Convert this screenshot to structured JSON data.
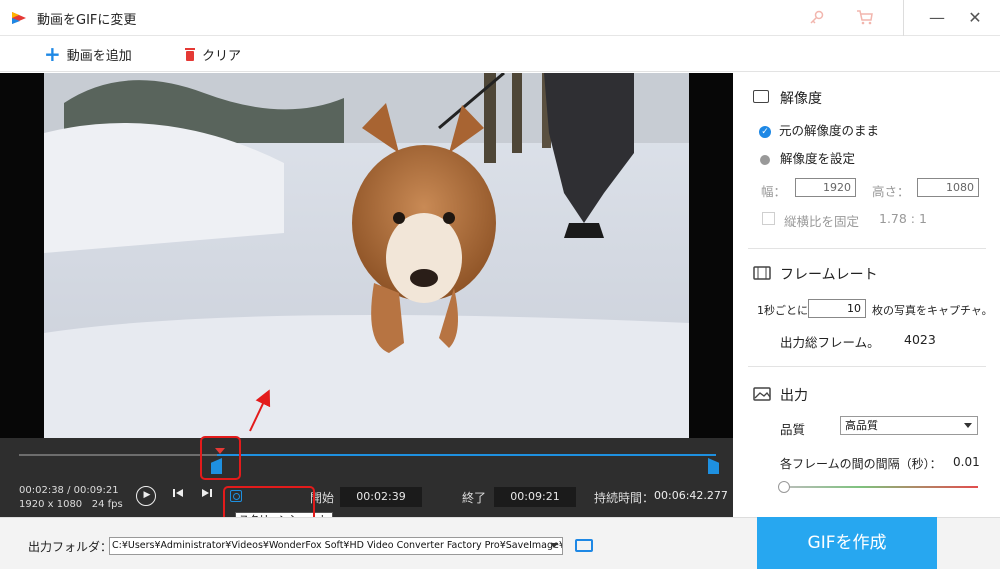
{
  "app": {
    "title": "動画をGIFに変更"
  },
  "icons": {
    "logo": "app-logo-icon",
    "key": "key-icon",
    "cart": "cart-icon"
  },
  "colors": {
    "accent": "#1e88e5",
    "create_button": "#27a7f0",
    "annotation": "#e31b1b"
  },
  "toolbar": {
    "add_video": "動画を追加",
    "clear": "クリア"
  },
  "player": {
    "current_time": "00:02:38",
    "separator": "/",
    "total_time": "00:09:21",
    "resolution": "1920 x 1080",
    "fps": "24 fps",
    "start_label": "開始",
    "start_time": "00:02:39",
    "end_label": "終了",
    "end_time": "00:09:21",
    "duration_label": "持続時間：",
    "duration": "00:06:42.277",
    "tooltip": "スクリーンショット"
  },
  "resolution": {
    "title": "解像度",
    "keep_original": "元の解像度のまま",
    "set_resolution": "解像度を設定",
    "width_label": "幅：",
    "width": "1920",
    "height_label": "高さ：",
    "height": "1080",
    "aspect_label": "縦横比を固定",
    "aspect_value": "1.78 : 1"
  },
  "framerate": {
    "title": "フレームレート",
    "prefix": "1秒ごとに",
    "value": "10",
    "suffix": "枚の写真をキャプチャ。",
    "total_label": "出力総フレーム。",
    "total": "4023"
  },
  "output": {
    "title": "出力",
    "quality_label": "品質",
    "quality": "高品質",
    "interval_label": "各フレームの間の間隔（秒）：",
    "interval": "0.01"
  },
  "bottom": {
    "folder_label": "出力フォルダ：",
    "folder_path": "C:¥Users¥Administrator¥Videos¥WonderFox Soft¥HD Video Converter Factory Pro¥SaveImage¥",
    "create_button": "GIFを作成"
  }
}
